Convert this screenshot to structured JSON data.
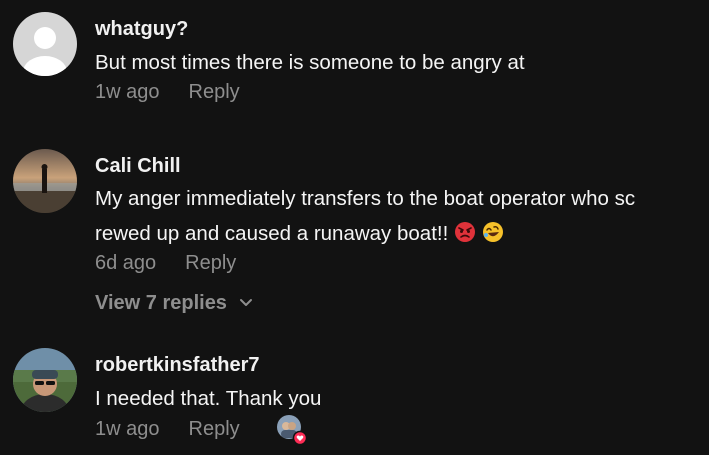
{
  "comments": [
    {
      "username": "whatguy?",
      "text": "But most times there is someone to be angry at",
      "time": "1w ago",
      "reply_label": "Reply",
      "avatar_icon": "default-user-avatar"
    },
    {
      "username": "Cali Chill",
      "text_line1": "My anger immediately transfers to the boat operator who sc",
      "text_line2": "rewed up and caused a runaway boat!!",
      "emojis": [
        "angry-face-emoji",
        "rolling-on-floor-laughing-emoji"
      ],
      "time": "6d ago",
      "reply_label": "Reply",
      "view_replies": "View 7 replies",
      "avatar_icon": "sunset-beach-avatar"
    },
    {
      "username": "robertkinsfather7",
      "text": "I needed that. Thank you",
      "time": "1w ago",
      "reply_label": "Reply",
      "avatar_icon": "person-sunglasses-avatar",
      "creator_liked_icon": "creator-heart-avatar"
    }
  ],
  "colors": {
    "background": "#121212",
    "primary_text": "#f5f5f5",
    "secondary_text": "#8e8e8e",
    "like_heart": "#fe2c55"
  }
}
